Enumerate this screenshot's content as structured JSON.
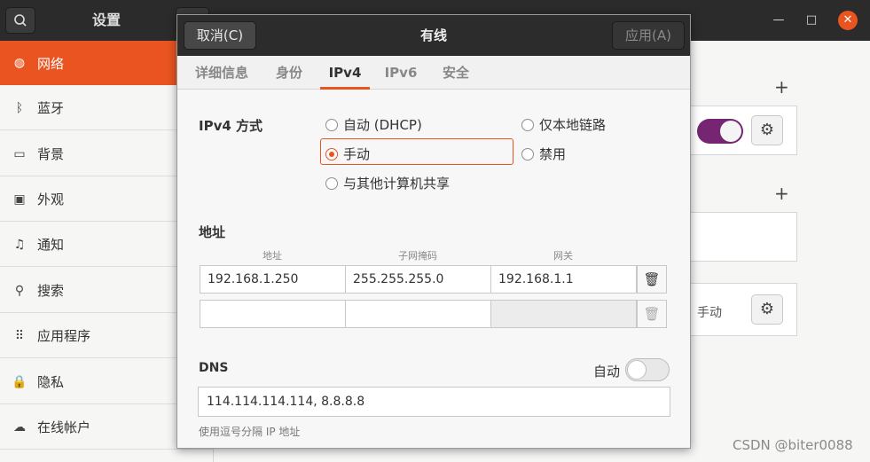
{
  "settings": {
    "title": "设置",
    "sidebar": [
      {
        "label": "网络",
        "icon": "network-icon",
        "glyph": "◍",
        "active": true
      },
      {
        "label": "蓝牙",
        "icon": "bluetooth-icon",
        "glyph": "ᛒ",
        "active": false
      },
      {
        "label": "背景",
        "icon": "background-icon",
        "glyph": "▭",
        "active": false
      },
      {
        "label": "外观",
        "icon": "appearance-icon",
        "glyph": "▣",
        "active": false
      },
      {
        "label": "通知",
        "icon": "bell-icon",
        "glyph": "♫",
        "active": false
      },
      {
        "label": "搜索",
        "icon": "search-icon",
        "glyph": "⚲",
        "active": false
      },
      {
        "label": "应用程序",
        "icon": "apps-icon",
        "glyph": "⠿",
        "active": false
      },
      {
        "label": "隐私",
        "icon": "lock-icon",
        "glyph": "🔒",
        "active": false
      },
      {
        "label": "在线帐户",
        "icon": "cloud-icon",
        "glyph": "☁",
        "active": false
      }
    ],
    "main": {
      "wired_toggle_on": true,
      "profile_mode": "手动"
    }
  },
  "dialog": {
    "title": "有线",
    "cancel_label": "取消(C)",
    "apply_label": "应用(A)",
    "tabs": [
      "详细信息",
      "身份",
      "IPv4",
      "IPv6",
      "安全"
    ],
    "active_tab": "IPv4",
    "ipv4_method_label": "IPv4 方式",
    "methods": {
      "auto": "自动 (DHCP)",
      "link_local": "仅本地链路",
      "manual": "手动",
      "disabled": "禁用",
      "shared": "与其他计算机共享"
    },
    "selected_method": "manual",
    "address_section_label": "地址",
    "columns": [
      "地址",
      "子网掩码",
      "网关"
    ],
    "rows": [
      {
        "address": "192.168.1.250",
        "netmask": "255.255.255.0",
        "gateway": "192.168.1.1"
      },
      {
        "address": "",
        "netmask": "",
        "gateway": ""
      }
    ],
    "dns_label": "DNS",
    "dns_auto_label": "自动",
    "dns_auto_on": false,
    "dns_value": "114.114.114.114, 8.8.8.8",
    "dns_hint": "使用逗号分隔 IP 地址"
  },
  "watermark": "CSDN @biter0088"
}
